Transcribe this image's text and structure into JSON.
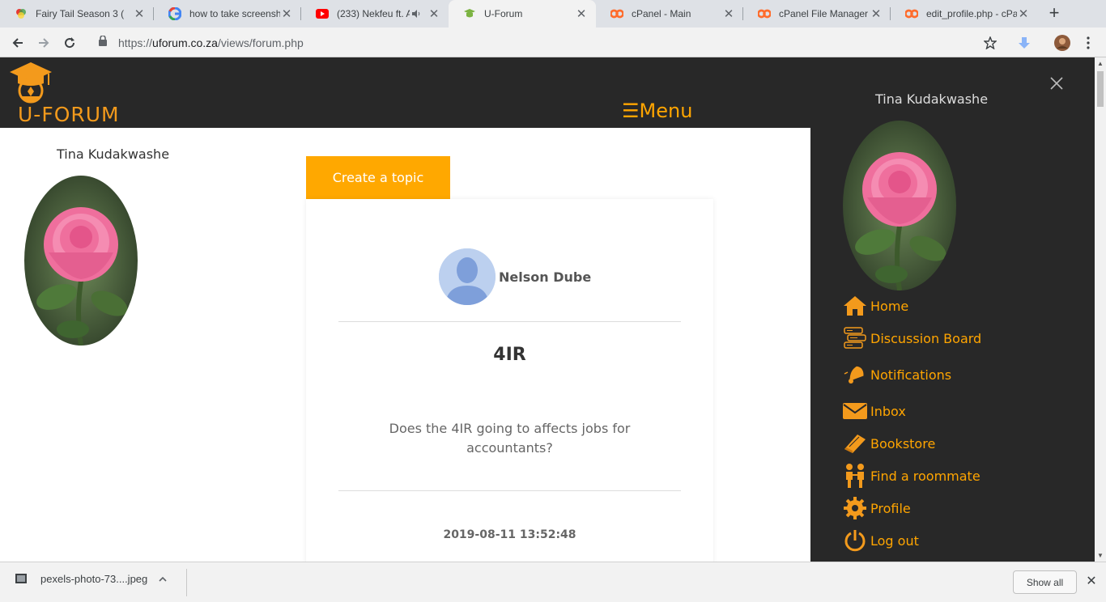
{
  "browser": {
    "tabs": [
      {
        "title": "Fairy Tail Season 3 (",
        "icon": "colorful-favicon-icon"
      },
      {
        "title": "how to take screensh",
        "icon": "google-icon"
      },
      {
        "title": "(233) Nekfeu ft. A",
        "icon": "youtube-icon"
      },
      {
        "title": "U-Forum",
        "icon": "uforum-favicon-icon"
      },
      {
        "title": "cPanel - Main",
        "icon": "cpanel-icon"
      },
      {
        "title": "cPanel File Manager",
        "icon": "cpanel-icon"
      },
      {
        "title": "edit_profile.php - cPa",
        "icon": "cpanel-icon"
      }
    ],
    "url_prefix": "https://",
    "url_domain": "uforum.co.za",
    "url_path": "/views/forum.php",
    "accent": "#ffa500"
  },
  "site": {
    "logo_text": "U-FORUM",
    "menu_label": "☰Menu",
    "user_name": "Tina Kudakwashe",
    "create_topic_label": "Create a topic"
  },
  "post": {
    "author": "Nelson Dube",
    "title": "4IR",
    "body": "Does the 4IR going to affects jobs for accountants?",
    "date": "2019-08-11 13:52:48"
  },
  "sidenav": {
    "user_name": "Tina Kudakwashe",
    "items": [
      {
        "label": "Home",
        "icon": "home-icon"
      },
      {
        "label": "Discussion Board",
        "icon": "discussion-board-icon"
      },
      {
        "label": "Notifications",
        "icon": "notification-bell-icon"
      },
      {
        "label": "Inbox",
        "icon": "envelope-icon"
      },
      {
        "label": "Bookstore",
        "icon": "book-icon"
      },
      {
        "label": "Find a roommate",
        "icon": "roommate-icon"
      },
      {
        "label": "Profile",
        "icon": "gear-icon"
      },
      {
        "label": "Log out",
        "icon": "power-icon"
      }
    ]
  },
  "downloads": {
    "file_name": "pexels-photo-73....jpeg",
    "show_all_label": "Show all"
  }
}
